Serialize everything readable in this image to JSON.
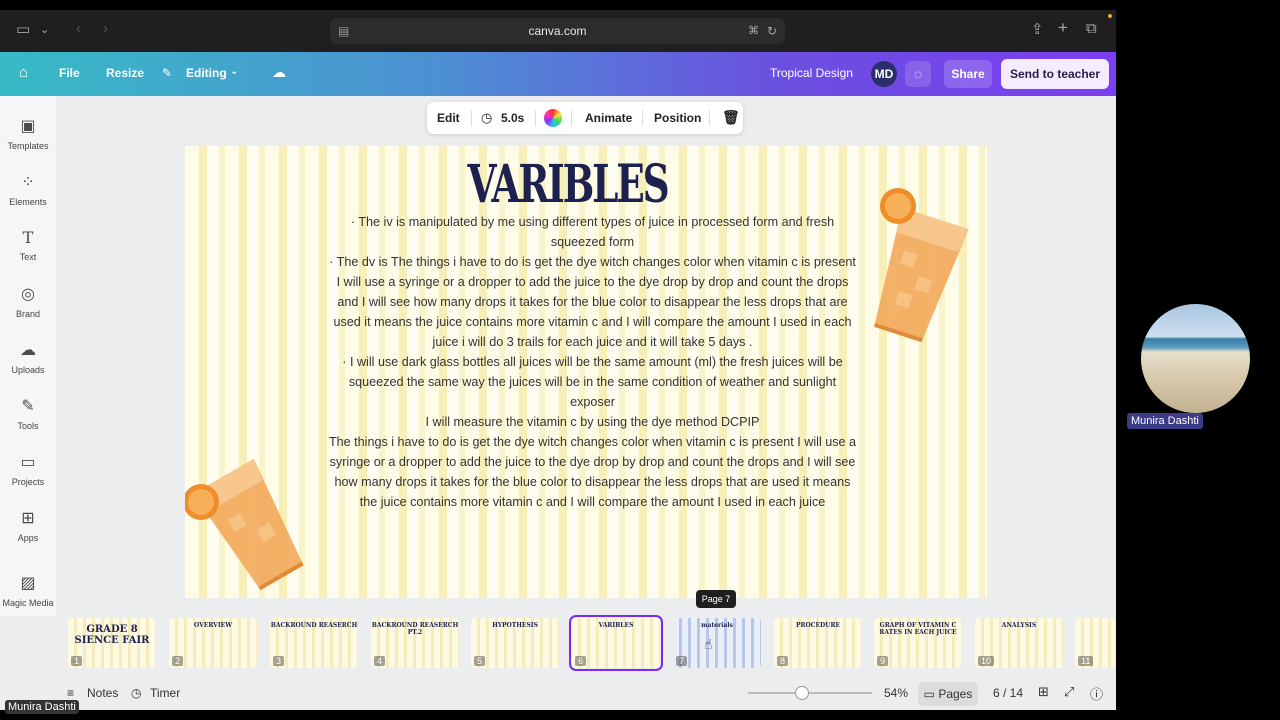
{
  "browser": {
    "url": "canva.com"
  },
  "header": {
    "file": "File",
    "resize": "Resize",
    "editing": "Editing",
    "design_name": "Tropical Design",
    "avatar_initials": "MD",
    "share": "Share",
    "send": "Send to teacher"
  },
  "sidebar": {
    "items": [
      {
        "label": "Templates",
        "icon": "templates-icon"
      },
      {
        "label": "Elements",
        "icon": "elements-icon"
      },
      {
        "label": "Text",
        "icon": "text-icon"
      },
      {
        "label": "Brand",
        "icon": "brand-icon"
      },
      {
        "label": "Uploads",
        "icon": "uploads-icon"
      },
      {
        "label": "Tools",
        "icon": "tools-icon"
      },
      {
        "label": "Projects",
        "icon": "projects-icon"
      },
      {
        "label": "Apps",
        "icon": "apps-icon"
      },
      {
        "label": "Magic Media",
        "icon": "magic-media-icon"
      }
    ]
  },
  "toolbar": {
    "edit": "Edit",
    "duration": "5.0s",
    "animate": "Animate",
    "position": "Position"
  },
  "slide": {
    "title": "VARIBLES",
    "lines": [
      "· The iv is manipulated by me using different types of juice in processed form and fresh squeezed form",
      "· The dv is The things i have to do is get the dye witch changes color when vitamin c is present I will use a syringe or a dropper to add the juice to the dye drop by drop and count the drops and I will see how many drops it takes for the blue color to disappear the less drops that are used it means the juice contains more vitamin c and I will compare the amount I used in each juice i will do 3 trails for each juice and it will take 5 days .",
      "· I will use dark glass bottles all juices will be the same amount (ml) the fresh juices will be squeezed the same way the juices will be in the same condition of weather and sunlight exposer",
      "I will measure the vitamin c by using the dye method DCPIP",
      "The things i have to do is get the dye witch changes color when vitamin c is present I will use a syringe or a dropper to add the juice to the dye drop by drop and count the drops and I will see how many drops it takes for the blue color to disappear the less drops that are used it means the juice contains more vitamin c and I will compare the amount I used in each juice"
    ]
  },
  "thumbnails": [
    {
      "num": "1",
      "title": "GRADE 8 SIENCE FAIR"
    },
    {
      "num": "2",
      "title": "OVERVIEW"
    },
    {
      "num": "3",
      "title": "BACKROUND REASERCH"
    },
    {
      "num": "4",
      "title": "BACKROUND REASERCH PT.2"
    },
    {
      "num": "5",
      "title": "HYPOTHESIS"
    },
    {
      "num": "6",
      "title": "VARIBLES"
    },
    {
      "num": "7",
      "title": "materials"
    },
    {
      "num": "8",
      "title": "PROCEDURE"
    },
    {
      "num": "9",
      "title": "GRAPH OF VITAMIN C RATES IN EACH JUICE"
    },
    {
      "num": "10",
      "title": "ANALYSIS"
    },
    {
      "num": "11",
      "title": ""
    }
  ],
  "tooltip": "Page 7",
  "bottom": {
    "notes": "Notes",
    "timer": "Timer",
    "zoom": "54%",
    "zoom_level": 0.37,
    "pages": "Pages",
    "page_count": "6 / 14"
  },
  "participant": {
    "name": "Munira Dashti"
  }
}
